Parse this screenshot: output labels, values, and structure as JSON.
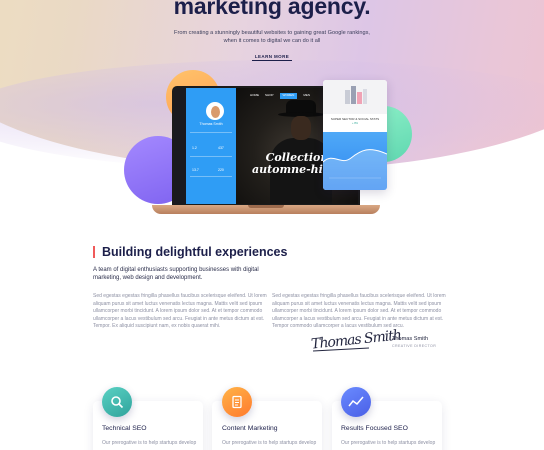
{
  "hero": {
    "headline": "marketing agency.",
    "subline": "From creating a stunningly beautiful websites to gaining great Google rankings, when it comes to digital we can do it all",
    "cta": "LEARN MORE"
  },
  "mockup": {
    "nav": [
      "HOME",
      "SHOP",
      "WOMEN",
      "MEN"
    ],
    "active_nav": "WOMEN",
    "profile_name": "Thomas Smith",
    "stats": [
      "1.2",
      "437",
      "13.7",
      "220"
    ],
    "collection_text_line1": "Collection",
    "collection_text_line2": "automne-hiver",
    "card_title": "SUPER SECTOR & SOCIAL STATS",
    "card_sub": "+ 8%"
  },
  "about": {
    "title": "Building delightful experiences",
    "intro": "A team of digital enthusiasts supporting businesses with digital marketing, web design and development.",
    "col1": "Sed egestas egestas fringilla phasellus faucibus scelerisque eleifend. Ut lorem aliquam purus sit amet luctus venenatis lectus magna. Mattis velit sed ipsum ullamcorper morbi tincidunt. A lorem ipsum dolor sed. At et tempor commodo ullamcorper a lacus vestibulum sed arcu. Feugiat in ante metus dictum at est. Tempor. Ex aliquid suscipiunt nam, ex nobis quaerat mihi.",
    "col2": "Sed egestas egestas fringilla phasellus faucibus scelerisque eleifend. Ut lorem aliquam purus sit amet luctus venenatis lectus magna. Mattis velit sed ipsum ullamcorper morbi tincidunt. A lorem ipsum dolor sed. At et tempor commodo ullamcorper a lacus vestibulum sed arcu. Feugiat in ante metus dictum at est. Tempor commodo ullamcorper a lacus vestibulum sed arcu.",
    "signature": "Thomas Smith",
    "signer_name": "Thomas Smith",
    "signer_role": "CREATIVE DIRECTOR"
  },
  "services": [
    {
      "title": "Technical SEO",
      "text": "Our prerogative is to help startups develop",
      "icon": "magnifier-icon",
      "color_a": "#5ad1c3",
      "color_b": "#2fa39c"
    },
    {
      "title": "Content Marketing",
      "text": "Our prerogative is to help startups develop",
      "icon": "document-icon",
      "color_a": "#ffb347",
      "color_b": "#ff7a2e"
    },
    {
      "title": "Results Focused SEO",
      "text": "Our prerogative is to help startups develop",
      "icon": "chart-line-icon",
      "color_a": "#6a8bff",
      "color_b": "#4a5fe6"
    }
  ]
}
